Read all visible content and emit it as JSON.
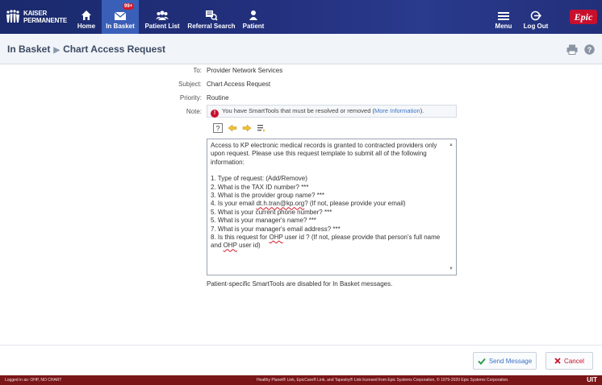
{
  "brand": {
    "line1": "KAISER",
    "line2": "PERMANENTE",
    "epic": "Epic"
  },
  "nav": {
    "home": "Home",
    "in_basket": "In Basket",
    "in_basket_badge": "99+",
    "patient_list": "Patient List",
    "referral_search": "Referral Search",
    "patient": "Patient",
    "menu": "Menu",
    "log_out": "Log Out"
  },
  "breadcrumb": {
    "root": "In Basket",
    "current": "Chart Access Request"
  },
  "form": {
    "to_label": "To:",
    "to_value": "Provider Network Services",
    "subject_label": "Subject:",
    "subject_value": "Chart Access Request",
    "priority_label": "Priority:",
    "priority_value": "Routine",
    "note_label": "Note:",
    "note_text": "You have SmartTools that must be resolved or removed (",
    "note_link": "More Information",
    "note_end": ")."
  },
  "editor": {
    "intro": "Access to KP electronic medical records is granted to contracted providers only upon request. Please use this request template to submit all of the following information:",
    "item1": "1. Type of request: (Add/Remove)",
    "item2": "2. What is the TAX ID number? ***",
    "item3": "3. What is the provider group name? ***",
    "item4a": "4. Is your email ",
    "item4email": "dt.h.tran@kp.org",
    "item4b": "? (If not, please provide your email)",
    "item5": "5. What is your current phone number? ***",
    "item6": "5. What is your manager's name? ***",
    "item7": "7. What is your manager's email address? ***",
    "item8a": "8. Is this request for ",
    "item8ohp": "OHP",
    "item8b": " user id ? (If not, please provide that person's full name and ",
    "item8ohp2": "OHP",
    "item8c": " user id)"
  },
  "disabled_note": "Patient-specific SmartTools are disabled for In Basket messages.",
  "actions": {
    "send": "Send Message",
    "cancel": "Cancel"
  },
  "footer": {
    "left": "Logged in as: OHP, NO CHART",
    "center": "Healthy Planet® Link, EpicCare® Link, and Tapestry® Link licensed from Epic Systems Corporation, © 1979-2020 Epic Systems Corporation.",
    "right": "UIT"
  },
  "colors": {
    "nav_bg": "#23307e",
    "nav_active": "#3a5fb8",
    "footer_bg": "#7a1518",
    "error_red": "#c8102e",
    "link_blue": "#3d74c6"
  }
}
